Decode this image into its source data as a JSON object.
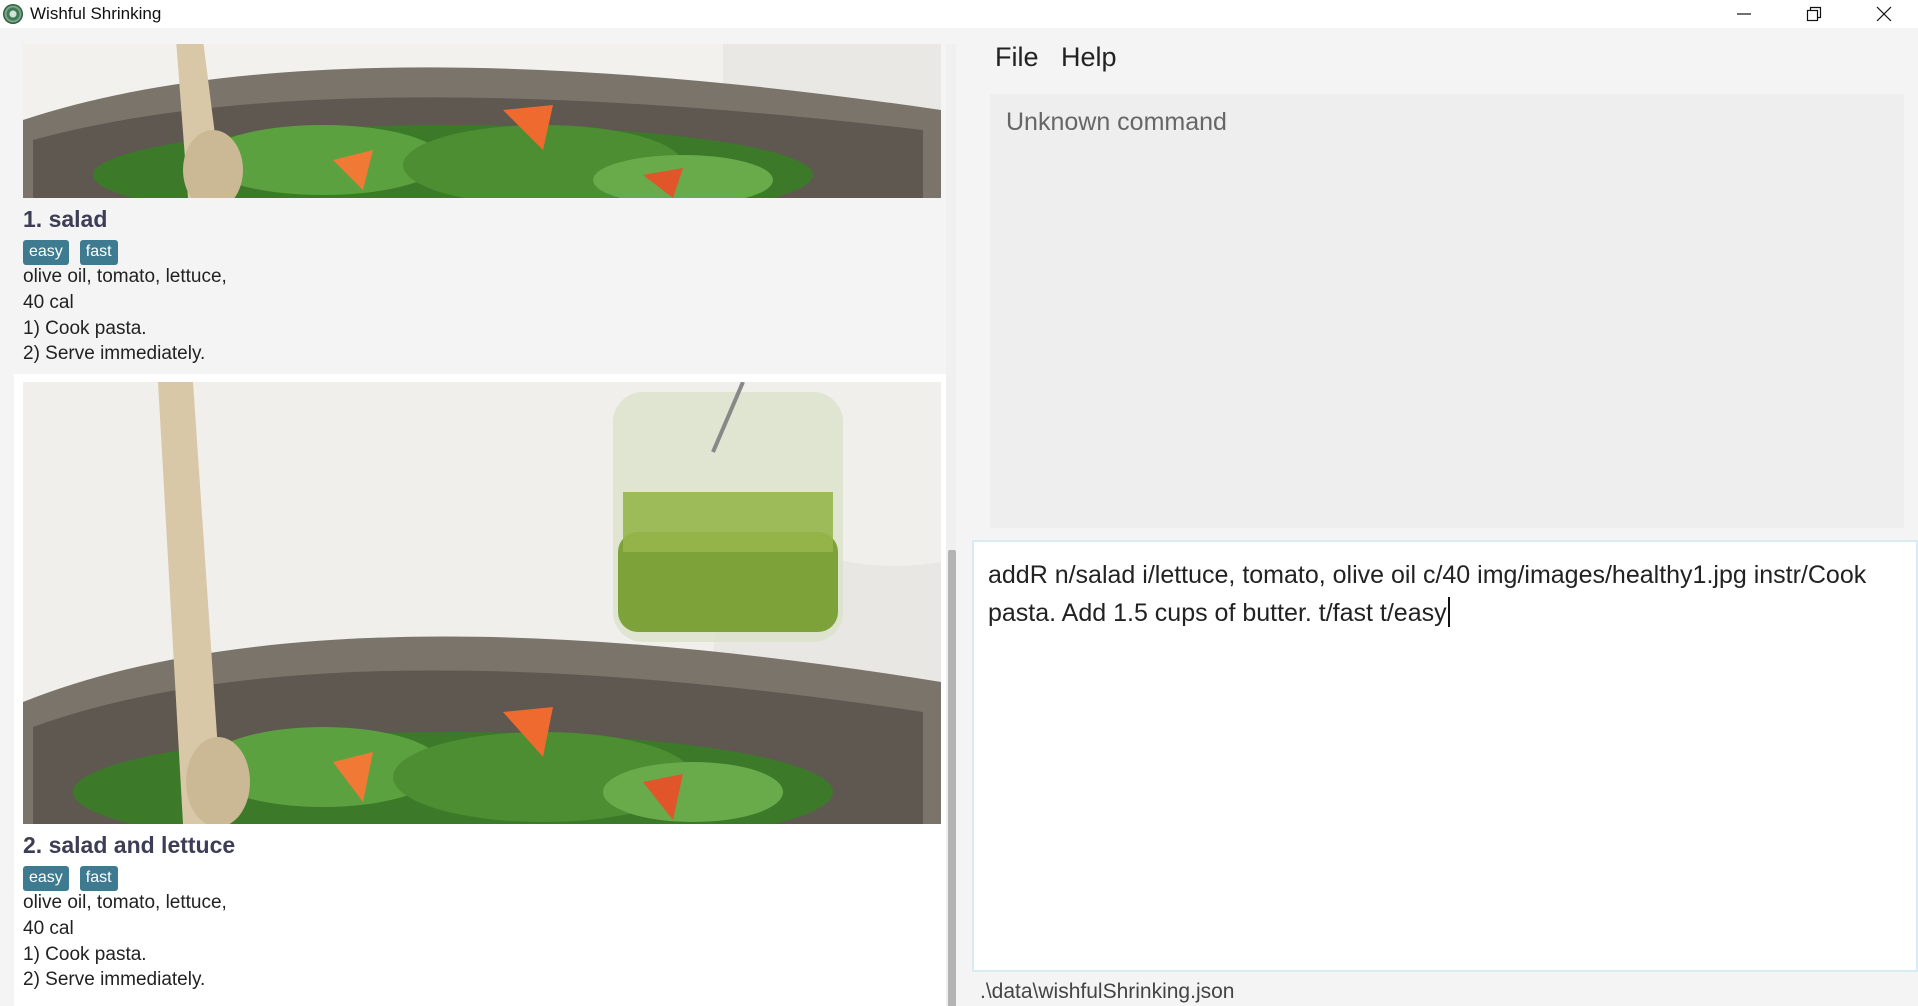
{
  "window": {
    "title": "Wishful Shrinking",
    "controls": [
      "minimize-icon",
      "restore-icon",
      "close-icon"
    ]
  },
  "recipes": [
    {
      "title": "1.  salad",
      "tags": [
        "easy",
        "fast"
      ],
      "ingredients": " olive oil,  tomato,  lettuce,",
      "calories": "40 cal",
      "instructions": [
        "1) Cook pasta.",
        "2) Serve immediately."
      ]
    },
    {
      "title": "2.  salad and lettuce",
      "tags": [
        "easy",
        "fast"
      ],
      "ingredients": " olive oil,  tomato,  lettuce,",
      "calories": "40 cal",
      "instructions": [
        "1) Cook pasta.",
        "2) Serve immediately."
      ]
    }
  ],
  "menu": {
    "file": "File",
    "help": "Help"
  },
  "result": {
    "text": "Unknown command"
  },
  "command": {
    "value": "addR n/salad i/lettuce, tomato, olive oil c/40 img/images/healthy1.jpg instr/Cook pasta. Add 1.5 cups of butter. t/fast t/easy"
  },
  "status": {
    "path": ".\\data\\wishfulShrinking.json"
  },
  "colors": {
    "tag_bg": "#3e7b91",
    "title_text": "#3d3d55",
    "panel_bg": "#f4f4f4"
  }
}
